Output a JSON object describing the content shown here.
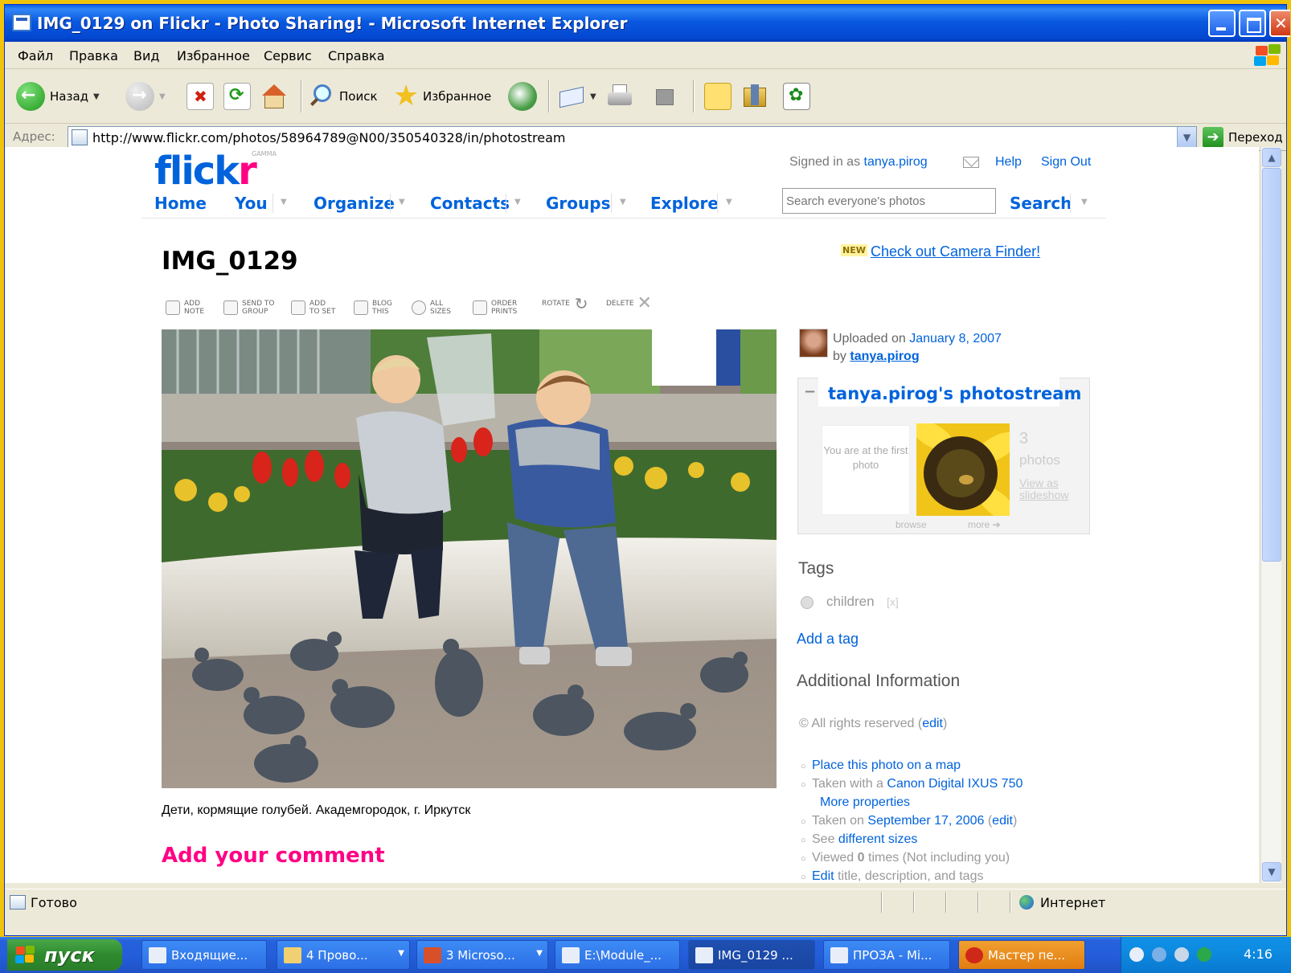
{
  "window": {
    "title": "IMG_0129 on Flickr - Photo Sharing! - Microsoft Internet Explorer"
  },
  "menu": {
    "items": [
      "Файл",
      "Правка",
      "Вид",
      "Избранное",
      "Сервис",
      "Справка"
    ]
  },
  "toolbar": {
    "back": "Назад",
    "search": "Поиск",
    "favorites": "Избранное"
  },
  "address": {
    "label": "Адрес:",
    "url": "http://www.flickr.com/photos/58964789@N00/350540328/in/photostream",
    "go": "Переход"
  },
  "flickr": {
    "logo_fl": "flick",
    "logo_kr": "r",
    "gamma": "GAMMA",
    "nav": [
      "Home",
      "You",
      "Organize",
      "Contacts",
      "Groups",
      "Explore"
    ],
    "signed_in_prefix": "Signed in as",
    "signed_in_user": "tanya.pirog",
    "help": "Help",
    "sign_out": "Sign Out",
    "search_placeholder": "Search everyone's photos",
    "search_button": "Search"
  },
  "photo": {
    "title": "IMG_0129",
    "new_badge": "NEW",
    "camera_finder": "Check out Camera Finder!",
    "tools": [
      [
        "ADD",
        "NOTE"
      ],
      [
        "SEND TO",
        "GROUP"
      ],
      [
        "ADD",
        "TO SET"
      ],
      [
        "BLOG",
        "THIS"
      ],
      [
        "ALL",
        "SIZES"
      ],
      [
        "ORDER",
        "PRINTS"
      ],
      [
        "ROTATE",
        ""
      ],
      [
        "DELETE",
        ""
      ]
    ],
    "caption": "Дети, кормящие голубей. Академгородок, г. Иркутск",
    "add_comment": "Add your comment"
  },
  "sidebar": {
    "uploaded_prefix": "Uploaded on",
    "uploaded_date": "January 8, 2007",
    "by": "by",
    "user": "tanya.pirog",
    "photostream_title": "tanya.pirog's photostream",
    "first_photo_note": "You are at the first photo",
    "photo_count": "3",
    "photos_word": "photos",
    "slideshow_1": "View as",
    "slideshow_2": "slideshow",
    "browse": "browse",
    "more": "more ➔",
    "tags_heading": "Tags",
    "tag": "children",
    "tag_remove": "[x]",
    "add_tag": "Add a tag",
    "additional_heading": "Additional Information",
    "rights_text": "© All rights reserved",
    "edit": "edit",
    "map_link": "Place this photo on a map",
    "taken_with_prefix": "Taken with a",
    "camera": "Canon Digital IXUS 750",
    "more_properties": "More properties",
    "taken_on_prefix": "Taken on",
    "taken_on_date": "September 17, 2006",
    "see_prefix": "See",
    "different_sizes": "different sizes",
    "viewed_prefix": "Viewed",
    "viewed_count": "0",
    "viewed_suffix": "times (Not including you)",
    "edit_link": "Edit",
    "edit_rest": "title, description, and tags"
  },
  "status": {
    "text": "Готово",
    "zone": "Интернет"
  },
  "taskbar": {
    "start": "пуск",
    "tasks": [
      "Входящие...",
      "4 Прово...",
      "3 Microso...",
      "E:\\Module_...",
      "IMG_0129 ...",
      "ПРОЗА - Mi...",
      "Мастер пе..."
    ],
    "clock": "4:16"
  },
  "colors": {
    "flickr_blue": "#0063dc",
    "flickr_pink": "#ff0084",
    "xp_blue": "#0a58e0",
    "start_green": "#2f8a2f"
  },
  "icons": [
    "back-arrow-icon",
    "forward-arrow-icon",
    "stop-icon",
    "refresh-icon",
    "home-icon",
    "search-icon",
    "favorites-star-icon",
    "history-icon",
    "mail-icon",
    "print-icon",
    "edit-icon",
    "folder-icon",
    "messenger-icon",
    "go-arrow-icon",
    "globe-icon",
    "windows-flag-icon"
  ]
}
